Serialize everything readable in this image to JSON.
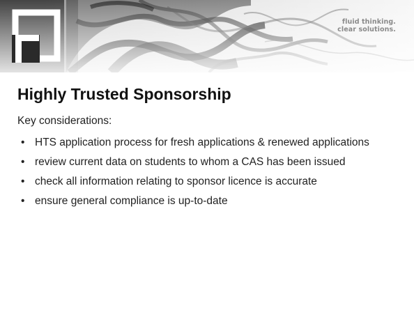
{
  "header": {
    "tagline_line1": "fluid thinking.",
    "tagline_line2": "clear solutions."
  },
  "slide": {
    "title": "Highly Trusted Sponsorship",
    "intro": "Key considerations:",
    "bullets": [
      "HTS application process for fresh applications & renewed applications",
      "review current data on students to whom a CAS has been issued",
      "check all information relating to sponsor licence is accurate",
      "ensure general compliance is up-to-date"
    ],
    "bullet_glyph": "•"
  },
  "colors": {
    "header_dark": "#1a1a1a",
    "header_light": "#e6e6e6",
    "tagline": "#8a8a8a",
    "text": "#222222"
  }
}
